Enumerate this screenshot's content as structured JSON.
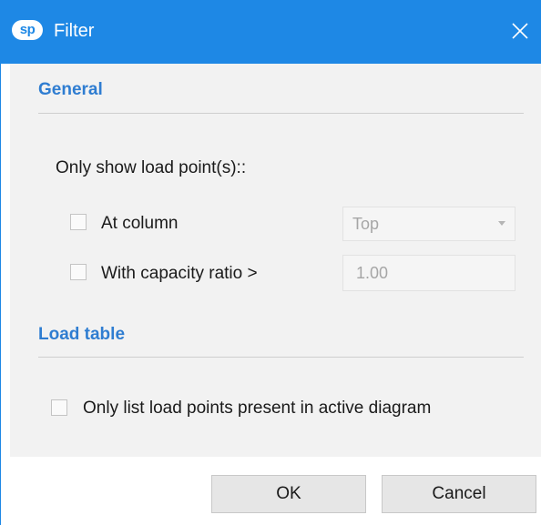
{
  "window": {
    "logo_text": "sp",
    "title": "Filter",
    "close_icon": "close-icon",
    "accent_color": "#1e88e5"
  },
  "general": {
    "title": "General",
    "prompt": "Only show load point(s)::",
    "at_column": {
      "label": "At column",
      "checked": false,
      "select_value": "Top",
      "enabled": false
    },
    "capacity_ratio": {
      "label": "With capacity ratio >",
      "checked": false,
      "value": "1.00",
      "enabled": false
    }
  },
  "load_table": {
    "title": "Load table",
    "only_list": {
      "label": "Only list load points present in active diagram",
      "checked": false
    }
  },
  "buttons": {
    "ok": "OK",
    "cancel": "Cancel"
  }
}
